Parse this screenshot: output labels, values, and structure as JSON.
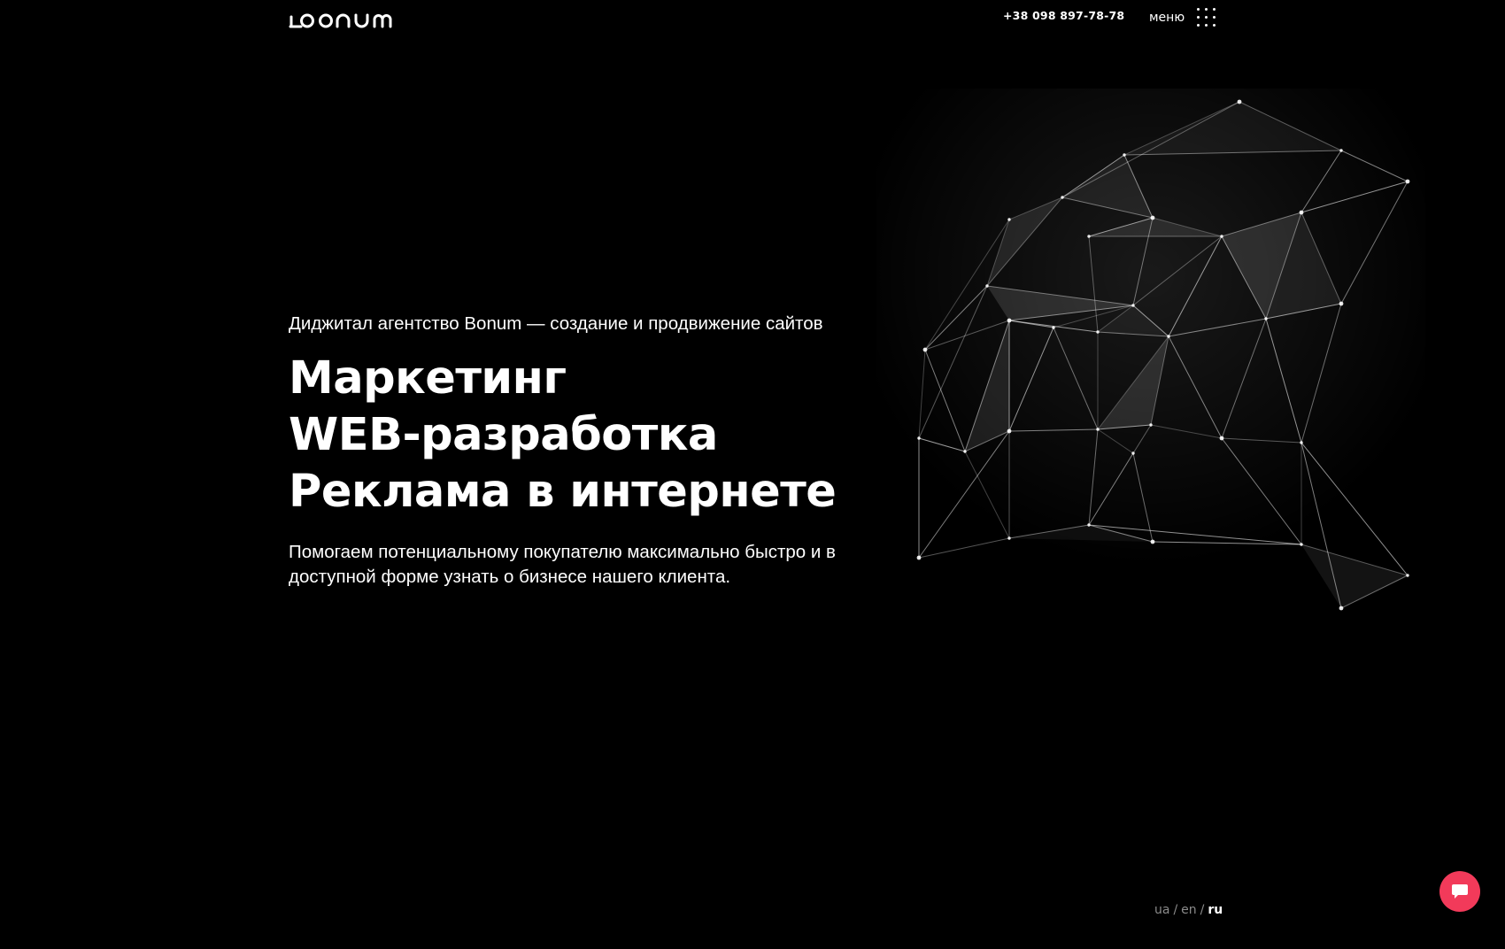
{
  "header": {
    "logo_text": "bonum",
    "phone": "+38 098 897-78-78",
    "menu_label": "меню"
  },
  "hero": {
    "subtitle": "Диджитал агентство Bonum — создание и продвижение сайтов",
    "titles": [
      "Маркетинг",
      "WEB-разработка",
      "Реклама в интернете"
    ],
    "description": "Помогаем потенциальному покупателю максимально быстро и в доступной форме узнать о бизнесе нашего клиента."
  },
  "lang": {
    "items": [
      "ua",
      "en",
      "ru"
    ],
    "separator": "/",
    "active": "ru"
  },
  "icons": {
    "menu": "grid-dots-icon",
    "chat": "chat-bubble-icon",
    "graphic": "network-mesh"
  },
  "colors": {
    "background": "#000000",
    "text": "#ffffff",
    "lang_inactive": "#8a8a8a",
    "chat_accent": "#f23a5a"
  }
}
